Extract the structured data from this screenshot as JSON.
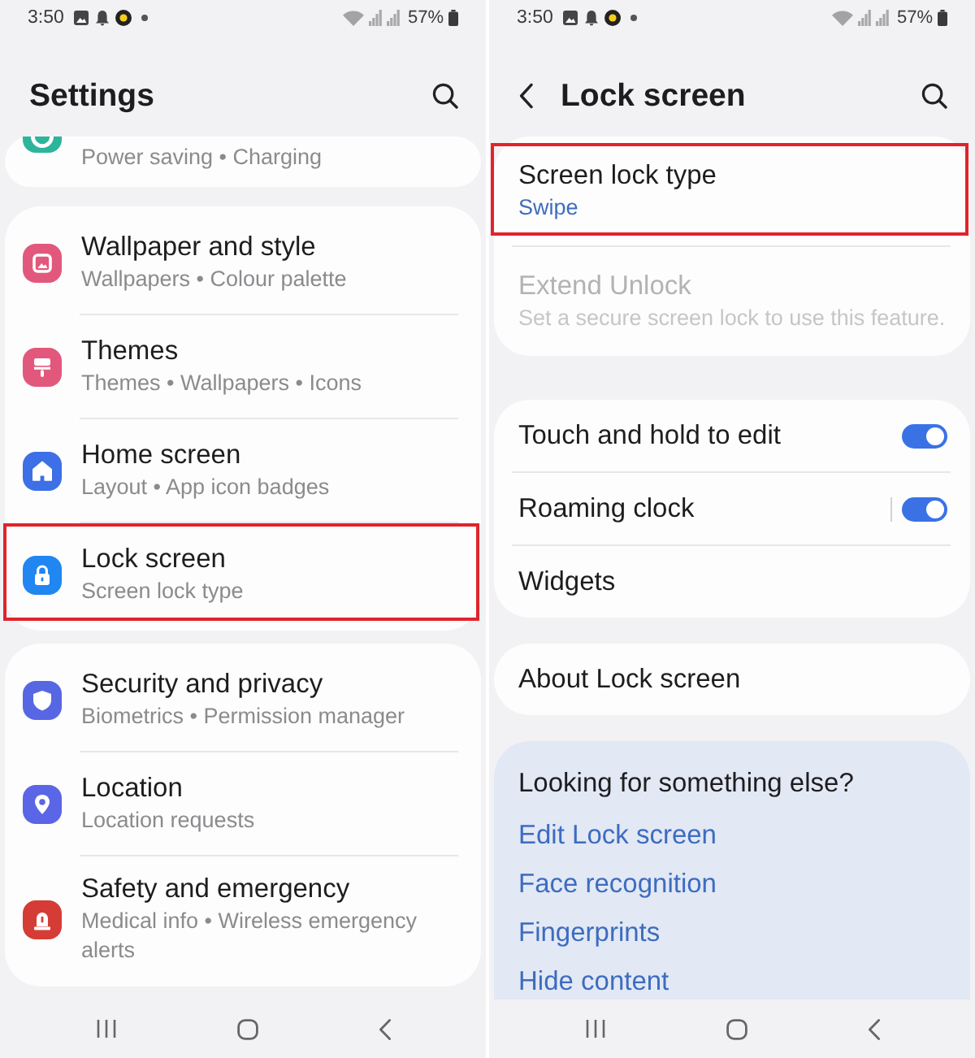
{
  "left_screen": {
    "status_bar": {
      "time": "3:50",
      "battery": "57%"
    },
    "title": "Settings",
    "partial_item": {
      "subtitle": "Power saving • Charging",
      "color": "#2db59b"
    },
    "groups": [
      {
        "items": [
          {
            "title": "Wallpaper and style",
            "subtitle": "Wallpapers • Colour palette",
            "color": "#e2587c",
            "highlighted": false
          },
          {
            "title": "Themes",
            "subtitle": "Themes • Wallpapers • Icons",
            "color": "#e2587c",
            "highlighted": false
          },
          {
            "title": "Home screen",
            "subtitle": "Layout • App icon badges",
            "color": "#3d6fe6",
            "highlighted": false
          },
          {
            "title": "Lock screen",
            "subtitle": "Screen lock type",
            "color": "#2086f2",
            "highlighted": true
          }
        ]
      },
      {
        "items": [
          {
            "title": "Security and privacy",
            "subtitle": "Biometrics • Permission manager",
            "color": "#5767e4",
            "highlighted": false
          },
          {
            "title": "Location",
            "subtitle": "Location requests",
            "color": "#5a66e6",
            "highlighted": false
          },
          {
            "title": "Safety and emergency",
            "subtitle": "Medical info • Wireless emergency alerts",
            "color": "#d63c36",
            "highlighted": false
          }
        ]
      }
    ]
  },
  "right_screen": {
    "status_bar": {
      "time": "3:50",
      "battery": "57%"
    },
    "title": "Lock screen",
    "groups": [
      {
        "rows": [
          {
            "kind": "setting",
            "title": "Screen lock type",
            "summary": "Swipe",
            "disabled": false,
            "highlighted": true
          },
          {
            "kind": "setting",
            "title": "Extend Unlock",
            "summary": "Set a secure screen lock to use this feature.",
            "disabled": true,
            "highlighted": false
          }
        ]
      },
      {
        "rows": [
          {
            "kind": "toggle",
            "title": "Touch and hold to edit",
            "on": true,
            "split": false,
            "disabled": false,
            "highlighted": false
          },
          {
            "kind": "toggle",
            "title": "Roaming clock",
            "on": true,
            "split": true,
            "disabled": false,
            "highlighted": false
          },
          {
            "kind": "setting",
            "title": "Widgets",
            "disabled": false,
            "highlighted": false
          }
        ]
      },
      {
        "rows": [
          {
            "kind": "setting",
            "title": "About Lock screen",
            "disabled": false,
            "highlighted": false
          }
        ]
      }
    ],
    "suggestions": {
      "title": "Looking for something else?",
      "links": [
        "Edit Lock screen",
        "Face recognition",
        "Fingerprints",
        "Hide content"
      ]
    }
  }
}
